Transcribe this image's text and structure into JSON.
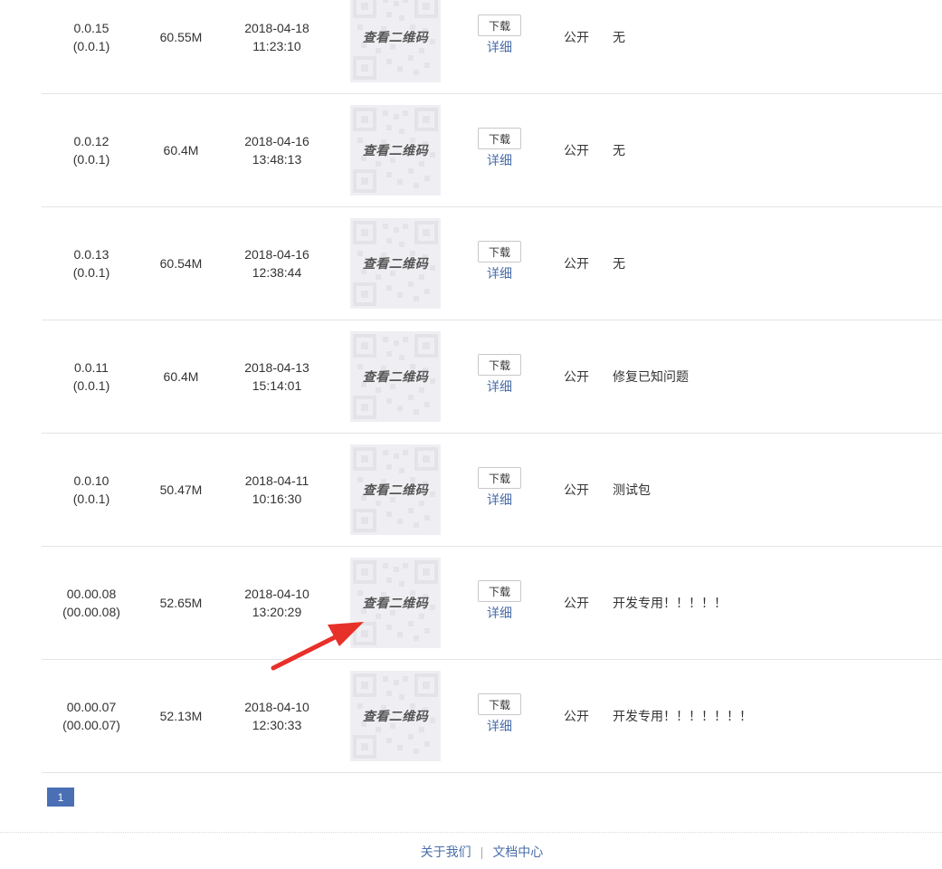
{
  "versions": [
    {
      "version": "0.0.15",
      "build": "(0.0.1)",
      "size": "60.55M",
      "date": "2018-04-18",
      "time": "11:23:10",
      "qr_label": "查看二维码",
      "download": "下载",
      "detail": "详细",
      "visibility": "公开",
      "note": "无"
    },
    {
      "version": "0.0.12",
      "build": "(0.0.1)",
      "size": "60.4M",
      "date": "2018-04-16",
      "time": "13:48:13",
      "qr_label": "查看二维码",
      "download": "下载",
      "detail": "详细",
      "visibility": "公开",
      "note": "无"
    },
    {
      "version": "0.0.13",
      "build": "(0.0.1)",
      "size": "60.54M",
      "date": "2018-04-16",
      "time": "12:38:44",
      "qr_label": "查看二维码",
      "download": "下载",
      "detail": "详细",
      "visibility": "公开",
      "note": "无"
    },
    {
      "version": "0.0.11",
      "build": "(0.0.1)",
      "size": "60.4M",
      "date": "2018-04-13",
      "time": "15:14:01",
      "qr_label": "查看二维码",
      "download": "下载",
      "detail": "详细",
      "visibility": "公开",
      "note": "修复已知问题"
    },
    {
      "version": "0.0.10",
      "build": "(0.0.1)",
      "size": "50.47M",
      "date": "2018-04-11",
      "time": "10:16:30",
      "qr_label": "查看二维码",
      "download": "下载",
      "detail": "详细",
      "visibility": "公开",
      "note": "测试包"
    },
    {
      "version": "00.00.08",
      "build": "(00.00.08)",
      "size": "52.65M",
      "date": "2018-04-10",
      "time": "13:20:29",
      "qr_label": "查看二维码",
      "download": "下载",
      "detail": "详细",
      "visibility": "公开",
      "note": "开发专用！！！！！"
    },
    {
      "version": "00.00.07",
      "build": "(00.00.07)",
      "size": "52.13M",
      "date": "2018-04-10",
      "time": "12:30:33",
      "qr_label": "查看二维码",
      "download": "下载",
      "detail": "详细",
      "visibility": "公开",
      "note": "开发专用！！！！！！！"
    }
  ],
  "pagination": {
    "current": "1"
  },
  "footer": {
    "about": "关于我们",
    "separator": "|",
    "docs": "文档中心"
  },
  "colors": {
    "accent": "#4a6fb5",
    "link": "#4a6ea8",
    "annotation_arrow": "#e8302a"
  },
  "annotation": {
    "icon": "arrow-icon",
    "points_to": "qr-code-thumbnail"
  }
}
